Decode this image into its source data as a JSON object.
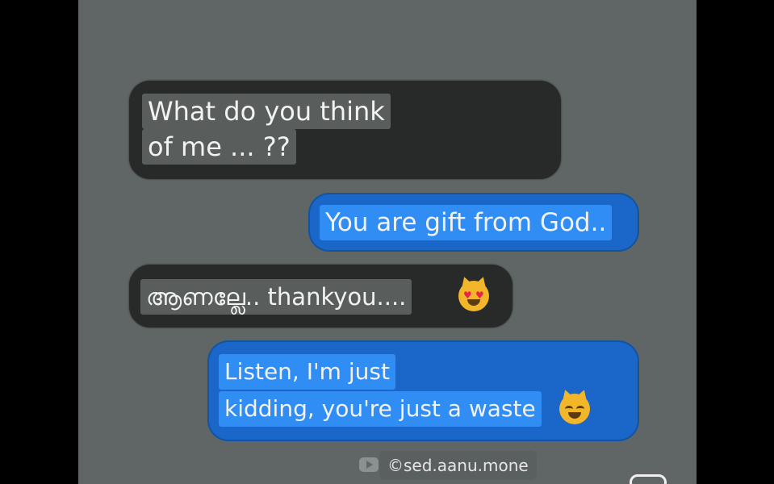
{
  "messages": [
    {
      "direction": "incoming",
      "lines": [
        "What do you think",
        "of me ... ??"
      ]
    },
    {
      "direction": "outgoing",
      "lines": [
        "You are gift from God.."
      ]
    },
    {
      "direction": "incoming",
      "lines": [
        "ആണല്ലേ.. thankyou...."
      ],
      "emoji": "heart-eyes-cat-emoji"
    },
    {
      "direction": "outgoing",
      "lines": [
        "Listen, I'm just",
        "kidding, you're just a waste"
      ],
      "emoji": "grinning-cat-emoji"
    }
  ],
  "watermark": {
    "text": "©sed.aanu.mone",
    "icon": "youtube-icon"
  },
  "colors": {
    "background": "#5f6665",
    "incoming_bubble": "#272a29",
    "incoming_highlight": "#595d5c",
    "outgoing_bubble": "#1a66c9",
    "outgoing_highlight": "#2f8df3"
  }
}
